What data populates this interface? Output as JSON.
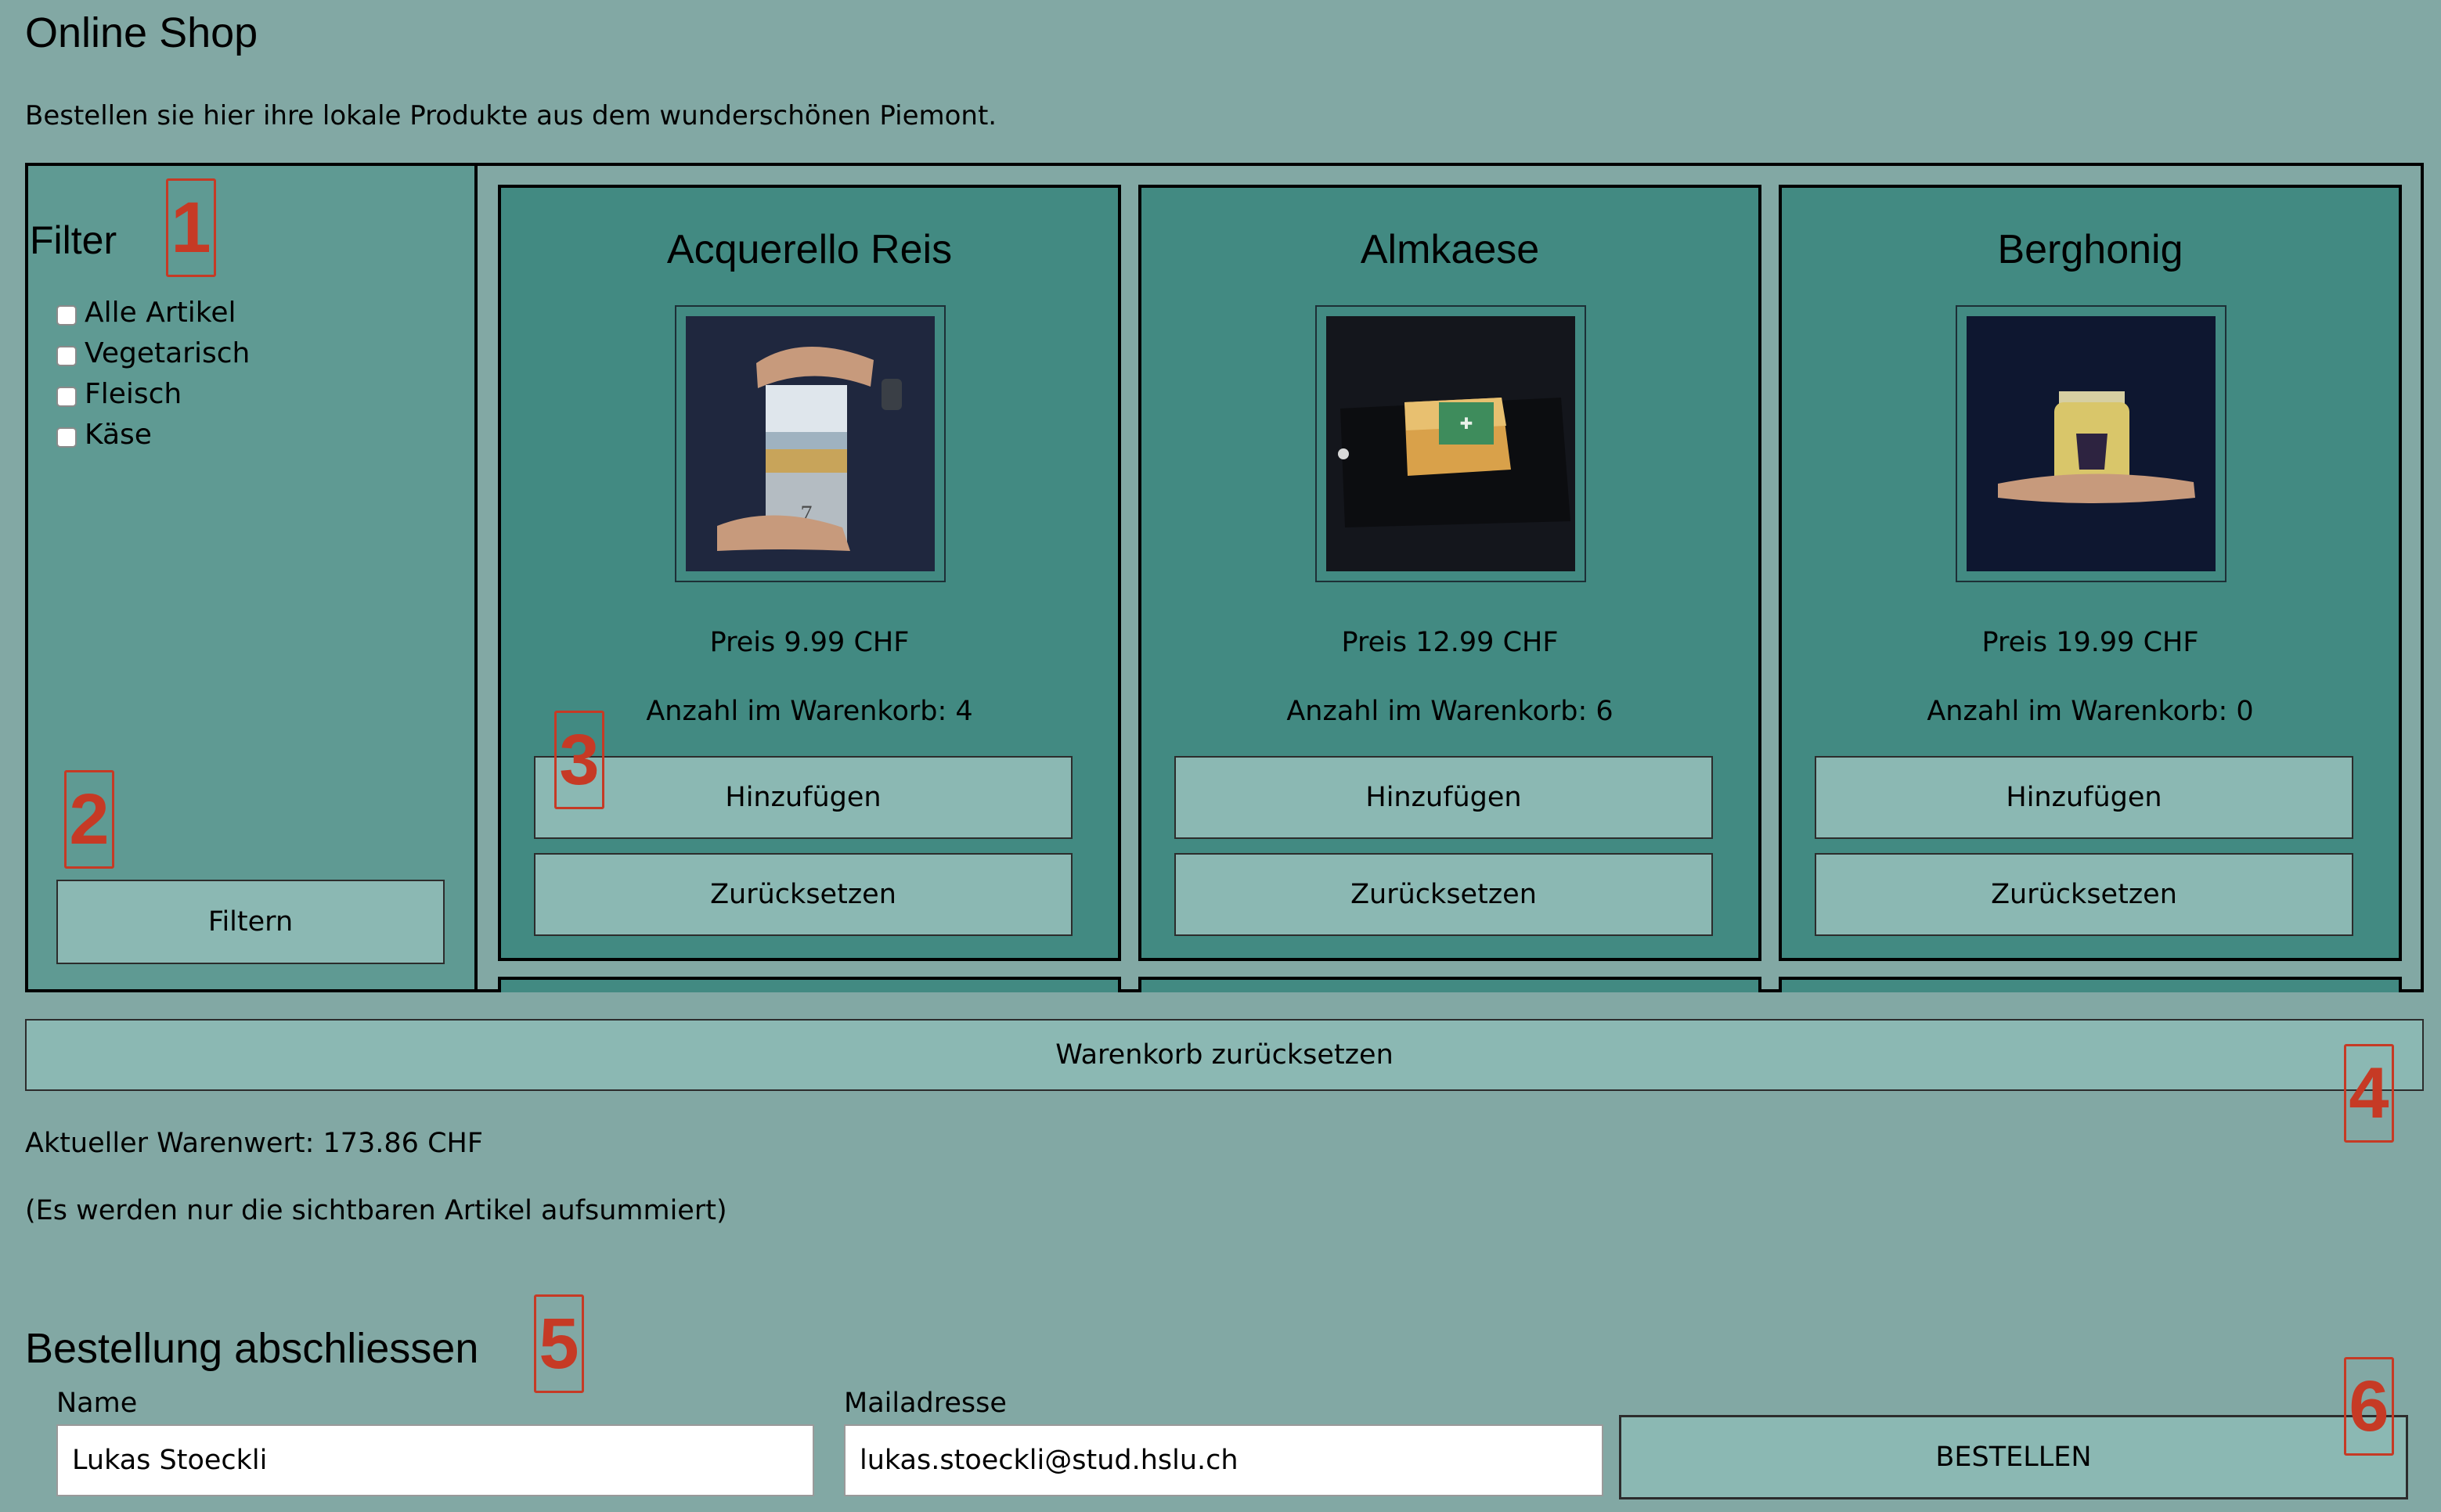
{
  "header": {
    "title": "Online Shop",
    "intro": "Bestellen sie hier ihre lokale Produkte aus dem wunderschönen Piemont."
  },
  "filter": {
    "heading": "Filter",
    "options": [
      {
        "label": "Alle Artikel",
        "checked": false
      },
      {
        "label": "Vegetarisch",
        "checked": false
      },
      {
        "label": "Fleisch",
        "checked": false
      },
      {
        "label": "Käse",
        "checked": false
      }
    ],
    "button_label": "Filtern"
  },
  "products": [
    {
      "name": "Acquerello Reis",
      "image_icon": "rice-tin-product-photo",
      "price_label": "Preis 9.99 CHF",
      "cart_count_label": "Anzahl im Warenkorb: 4",
      "add_label": "Hinzufügen",
      "reset_label": "Zurücksetzen"
    },
    {
      "name": "Almkaese",
      "image_icon": "cheese-product-photo",
      "price_label": "Preis 12.99 CHF",
      "cart_count_label": "Anzahl im Warenkorb: 6",
      "add_label": "Hinzufügen",
      "reset_label": "Zurücksetzen"
    },
    {
      "name": "Berghonig",
      "image_icon": "honey-jar-product-photo",
      "price_label": "Preis 19.99 CHF",
      "cart_count_label": "Anzahl im Warenkorb: 0",
      "add_label": "Hinzufügen",
      "reset_label": "Zurücksetzen"
    }
  ],
  "cart": {
    "reset_all_label": "Warenkorb zurücksetzen",
    "total_label": "Aktueller Warenwert: 173.86 CHF",
    "note": "(Es werden nur die sichtbaren Artikel aufsummiert)"
  },
  "order": {
    "heading": "Bestellung abschliessen",
    "name_label": "Name",
    "name_value": "Lukas Stoeckli",
    "email_label": "Mailadresse",
    "email_value": "lukas.stoeckli@stud.hslu.ch",
    "submit_label": "BESTELLEN"
  },
  "markers": [
    "1",
    "2",
    "3",
    "4",
    "5",
    "6"
  ],
  "colors": {
    "page_background": "#82a8a4",
    "panel_background": "#5f9a93",
    "card_background": "#428a82",
    "button_background": "#8bb8b3",
    "marker_red": "#c63a25"
  }
}
